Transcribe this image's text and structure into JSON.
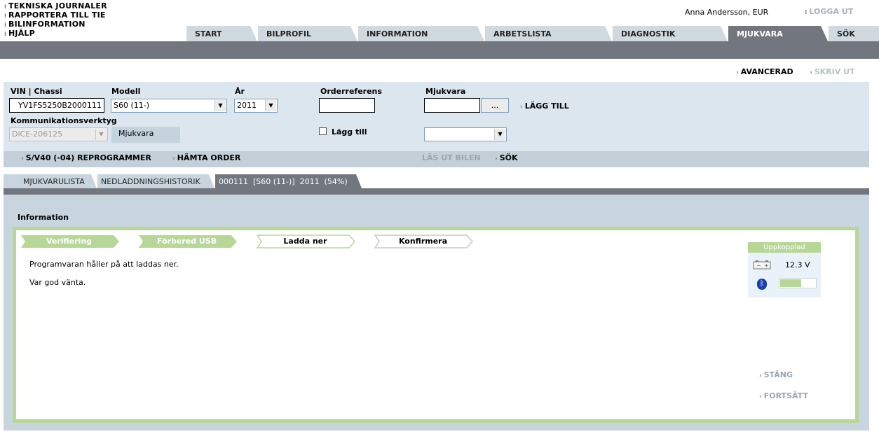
{
  "top_links": [
    "TEKNISKA JOURNALER",
    "RAPPORTERA TILL TIE",
    "BILINFORMATION",
    "HJÄLP"
  ],
  "user": "Anna Andersson, EUR",
  "logout": "LOGGA UT",
  "main_tabs": [
    {
      "label": "START",
      "active": false
    },
    {
      "label": "BILPROFIL",
      "active": false
    },
    {
      "label": "INFORMATION",
      "active": false
    },
    {
      "label": "ARBETSLISTA",
      "active": false
    },
    {
      "label": "DIAGNOSTIK",
      "active": false
    },
    {
      "label": "MJUKVARA",
      "active": true
    },
    {
      "label": "SÖK",
      "active": false
    }
  ],
  "actions_top": {
    "advanced": "AVANCERAD",
    "print": "SKRIV UT"
  },
  "form": {
    "vin_label": "VIN | Chassi",
    "vin_value": "YV1FS5250B2000111",
    "model_label": "Modell",
    "model_value": "S60 (11-)",
    "year_label": "År",
    "year_value": "2011",
    "order_label": "Orderreferens",
    "order_value": "",
    "software_label": "Mjukvara",
    "software_value": "",
    "browse_label": "...",
    "add_label": "LÄGG TILL",
    "comm_label": "Kommunikationsverktyg",
    "comm_value": "DiCE-206125",
    "comm_box": "Mjukvara",
    "checkbox_label": "Lägg till",
    "dropdown_value": ""
  },
  "action_bar": {
    "reprogram": "S/V40 (-04) REPROGRAMMER",
    "fetch_order": "HÄMTA ORDER",
    "read_car": "LÄS UT BILEN",
    "search": "SÖK"
  },
  "sub_tabs": [
    {
      "label": "MJUKVARULISTA",
      "active": false
    },
    {
      "label": "NEDLADDNINGSHISTORIK",
      "active": false
    },
    {
      "label": "000111  [S60 (11-)]  2011  (54%)",
      "active": true
    }
  ],
  "info_heading": "Information",
  "steps": [
    {
      "label": "Verifiering",
      "state": "done"
    },
    {
      "label": "Förbered USB",
      "state": "done"
    },
    {
      "label": "Ladda ner",
      "state": "current"
    },
    {
      "label": "Konfirmera",
      "state": "pending"
    }
  ],
  "messages": [
    "Programvaran håller på att laddas ner.",
    "Var god vänta."
  ],
  "status": {
    "header": "Uppkopplad",
    "voltage": "12.3 V",
    "signal_level": 0.6
  },
  "bottom_actions": {
    "close": "STÄNG",
    "continue": "FORTSÄTT"
  },
  "colors": {
    "accent_green": "#b7d796",
    "dark_bar": "#72777f",
    "panel": "#dce6ee"
  }
}
